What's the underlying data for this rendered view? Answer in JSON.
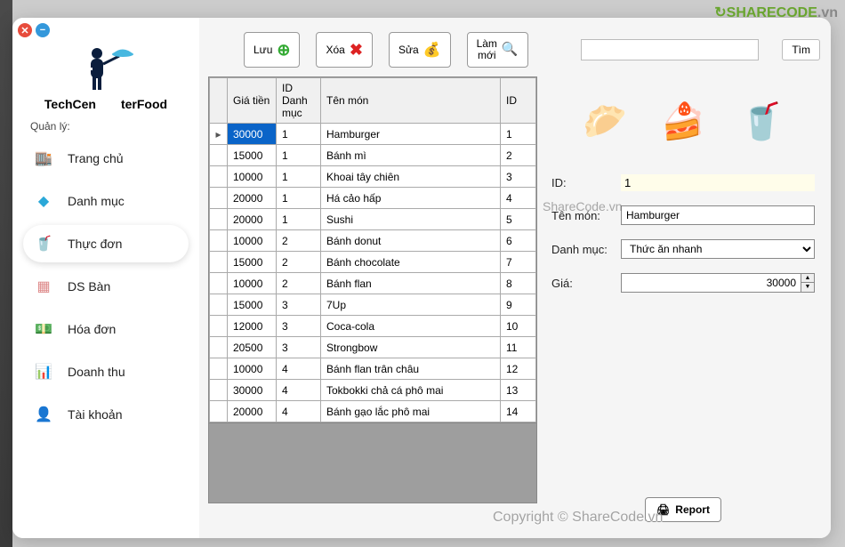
{
  "brand": {
    "left": "TechCen",
    "right": "terFood"
  },
  "section_label": "Quản lý:",
  "sidebar": {
    "items": [
      {
        "label": "Trang chủ"
      },
      {
        "label": "Danh mục"
      },
      {
        "label": "Thực đơn"
      },
      {
        "label": "DS Bàn"
      },
      {
        "label": "Hóa đơn"
      },
      {
        "label": "Doanh thu"
      },
      {
        "label": "Tài khoản"
      }
    ]
  },
  "toolbar": {
    "save": "Lưu",
    "delete": "Xóa",
    "edit": "Sửa",
    "refresh": "Làm\nmới",
    "search_btn": "Tìm",
    "search_value": ""
  },
  "table": {
    "headers": {
      "price": "Giá tiền",
      "cat": "ID Danh mục",
      "name": "Tên món",
      "id": "ID"
    },
    "rows": [
      {
        "price": "30000",
        "cat": "1",
        "name": "Hamburger",
        "id": "1",
        "selected": true
      },
      {
        "price": "15000",
        "cat": "1",
        "name": "Bánh mì",
        "id": "2"
      },
      {
        "price": "10000",
        "cat": "1",
        "name": "Khoai tây chiên",
        "id": "3"
      },
      {
        "price": "20000",
        "cat": "1",
        "name": "Há cảo hấp",
        "id": "4"
      },
      {
        "price": "20000",
        "cat": "1",
        "name": "Sushi",
        "id": "5"
      },
      {
        "price": "10000",
        "cat": "2",
        "name": "Bánh donut",
        "id": "6"
      },
      {
        "price": "15000",
        "cat": "2",
        "name": "Bánh chocolate",
        "id": "7"
      },
      {
        "price": "10000",
        "cat": "2",
        "name": "Bánh flan",
        "id": "8"
      },
      {
        "price": "15000",
        "cat": "3",
        "name": "7Up",
        "id": "9"
      },
      {
        "price": "12000",
        "cat": "3",
        "name": "Coca-cola",
        "id": "10"
      },
      {
        "price": "20500",
        "cat": "3",
        "name": "Strongbow",
        "id": "11"
      },
      {
        "price": "10000",
        "cat": "4",
        "name": "Bánh flan trân châu",
        "id": "12"
      },
      {
        "price": "30000",
        "cat": "4",
        "name": "Tokbokki chả cá phô mai",
        "id": "13"
      },
      {
        "price": "20000",
        "cat": "4",
        "name": "Bánh gạo lắc phô mai",
        "id": "14"
      }
    ]
  },
  "form": {
    "id_label": "ID:",
    "id_value": "1",
    "name_label": "Tên món:",
    "name_value": "Hamburger",
    "cat_label": "Danh mục:",
    "cat_value": "Thức ăn nhanh",
    "price_label": "Giá:",
    "price_value": "30000"
  },
  "report_btn": "Report",
  "watermark": {
    "brand": "SHARECODE",
    "suffix": ".vn",
    "center": "ShareCode.vn",
    "bottom": "Copyright © ShareCode.vn"
  }
}
